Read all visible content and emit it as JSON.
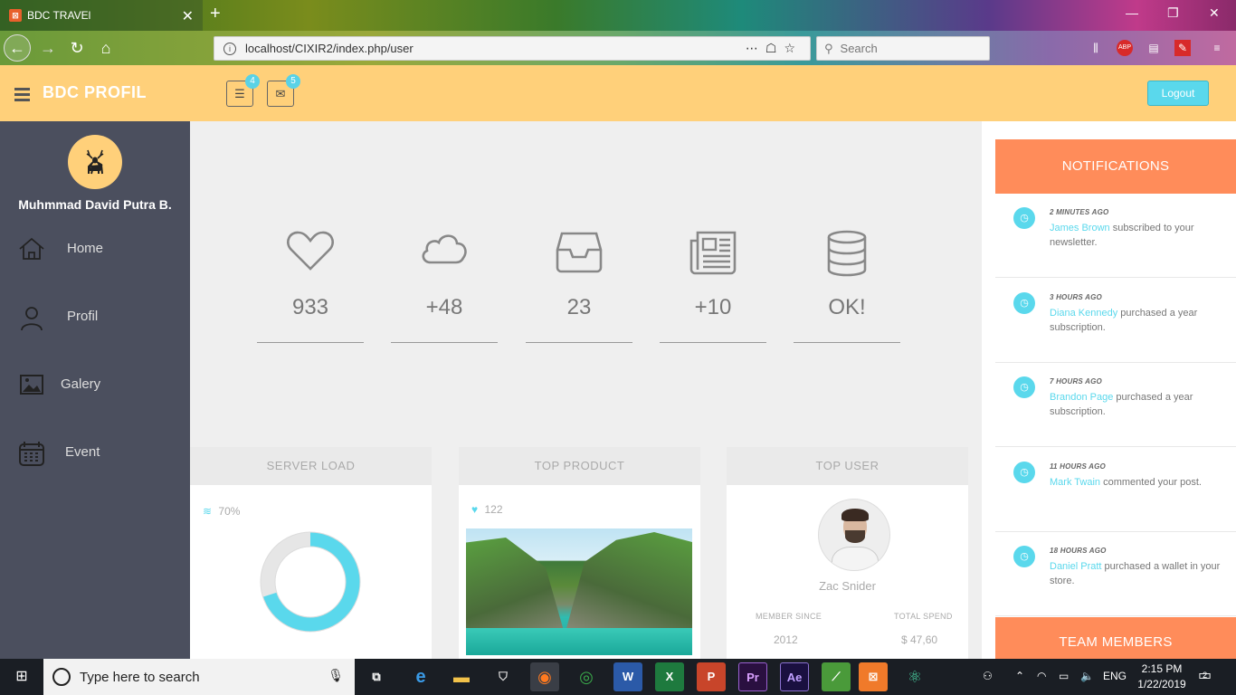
{
  "browser": {
    "tab_title": "BDC TRAVEl",
    "url": "localhost/CIXIR2/index.php/user",
    "search_placeholder": "Search"
  },
  "header": {
    "brand": "BDC PROFIL",
    "tasks_badge": "4",
    "messages_badge": "5",
    "logout_label": "Logout"
  },
  "sidebar": {
    "user_name": "Muhmmad David Putra B.",
    "items": [
      {
        "label": "Home",
        "icon": "home-icon"
      },
      {
        "label": "Profil",
        "icon": "user-icon"
      },
      {
        "label": "Galery",
        "icon": "image-icon"
      },
      {
        "label": "Event",
        "icon": "calendar-icon"
      }
    ]
  },
  "stats": [
    {
      "icon": "heart-icon",
      "value": "933"
    },
    {
      "icon": "cloud-icon",
      "value": "+48"
    },
    {
      "icon": "inbox-icon",
      "value": "23"
    },
    {
      "icon": "newspaper-icon",
      "value": "+10"
    },
    {
      "icon": "database-icon",
      "value": "OK!"
    }
  ],
  "cards": {
    "server_load": {
      "title": "SERVER LOAD",
      "value_label": "70%",
      "load_fraction": 0.7
    },
    "top_product": {
      "title": "TOP PRODUCT",
      "likes": "122"
    },
    "top_user": {
      "title": "TOP USER",
      "name": "Zac Snider",
      "member_since_label": "MEMBER SINCE",
      "member_since_value": "2012",
      "total_spend_label": "TOTAL SPEND",
      "total_spend_value": "$ 47,60"
    }
  },
  "notifications": {
    "title": "NOTIFICATIONS",
    "items": [
      {
        "time": "2 MINUTES AGO",
        "name": "James Brown",
        "text": " subscribed to your newsletter."
      },
      {
        "time": "3 HOURS AGO",
        "name": "Diana Kennedy",
        "text": " purchased a year subscription."
      },
      {
        "time": "7 HOURS AGO",
        "name": "Brandon Page",
        "text": " purchased a year subscription."
      },
      {
        "time": "11 HOURS AGO",
        "name": "Mark Twain",
        "text": " commented your post."
      },
      {
        "time": "18 HOURS AGO",
        "name": "Daniel Pratt",
        "text": " purchased a wallet in your store."
      }
    ],
    "team_title": "TEAM MEMBERS"
  },
  "taskbar": {
    "search_placeholder": "Type here to search",
    "language": "ENG",
    "time": "2:15 PM",
    "date": "1/22/2019",
    "notification_count": "2"
  },
  "colors": {
    "header_bg": "#ffd07a",
    "sidebar_bg": "#4b4f5e",
    "accent_cyan": "#5ad8ec",
    "accent_orange": "#ff8c5a"
  }
}
